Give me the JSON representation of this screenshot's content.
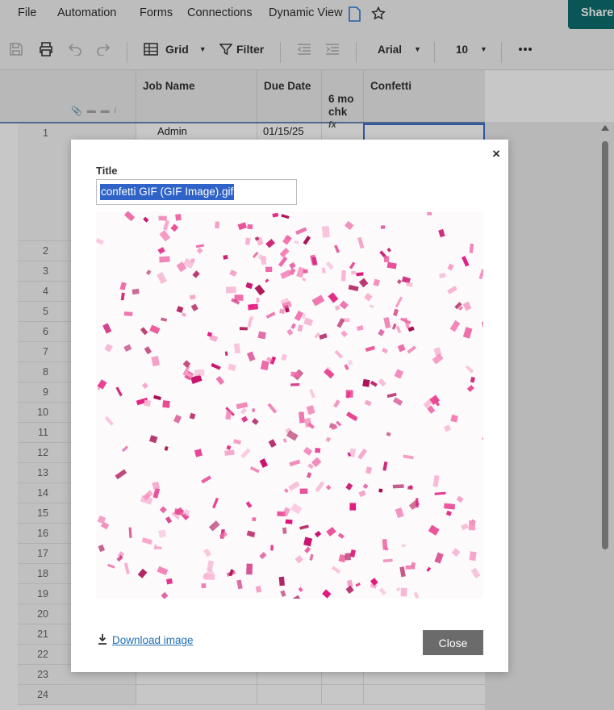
{
  "menu": {
    "file": "File",
    "automation": "Automation",
    "forms": "Forms",
    "connections": "Connections",
    "dynamic_view": "Dynamic View",
    "share": "Share"
  },
  "toolbar": {
    "view_mode": "Grid",
    "filter": "Filter",
    "font": "Arial",
    "font_size": "10"
  },
  "grid": {
    "columns": [
      "Job Name",
      "Due Date",
      "6 mo\nchk",
      "Confetti"
    ],
    "formula_symbol": "fx",
    "row1": {
      "num": "1",
      "job_name": "Admin",
      "due_date": "01/15/25"
    },
    "row_numbers": [
      "2",
      "3",
      "4",
      "5",
      "6",
      "7",
      "8",
      "9",
      "10",
      "11",
      "12",
      "13",
      "14",
      "15",
      "16",
      "17",
      "18",
      "19",
      "20",
      "21",
      "22",
      "23",
      "24"
    ]
  },
  "modal": {
    "title_label": "Title",
    "title_value": "confetti GIF (GIF Image).gif",
    "download_label": "Download image",
    "close_label": "Close",
    "close_x": "×",
    "confetti_color": "#e0147a"
  },
  "colors": {
    "accent": "#0d6e6e",
    "selection": "#2f63c7",
    "link": "#1f6fb2"
  }
}
